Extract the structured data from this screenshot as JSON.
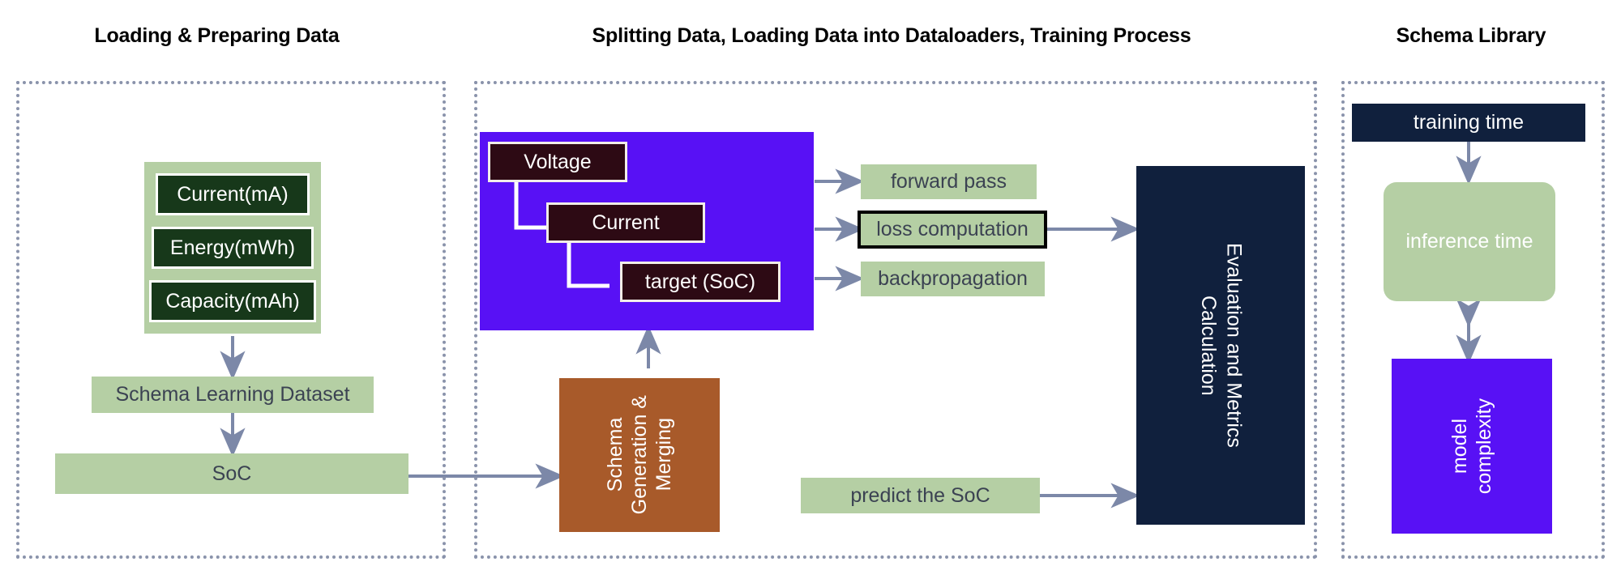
{
  "columns": [
    {
      "title": "Loading & Preparing Data"
    },
    {
      "title": "Splitting Data, Loading Data into Dataloaders, Training Process"
    },
    {
      "title": "Schema Library"
    }
  ],
  "left_column": {
    "feature_group": {
      "items": [
        {
          "label": "Current(mA)"
        },
        {
          "label": "Energy(mWh)"
        },
        {
          "label": "Capacity(mAh)"
        }
      ]
    },
    "dataset": {
      "label": "Schema Learning Dataset"
    },
    "target": {
      "label": "SoC"
    }
  },
  "middle_column": {
    "schema_box": {
      "nodes": [
        {
          "label": "Voltage"
        },
        {
          "label": "Current"
        },
        {
          "label": "target (SoC)"
        }
      ]
    },
    "steps": [
      {
        "label": "forward pass",
        "highlighted": false
      },
      {
        "label": "loss computation",
        "highlighted": true
      },
      {
        "label": "backpropagation",
        "highlighted": false
      }
    ],
    "schema_generation": {
      "label": "Schema\nGeneration &\nMerging",
      "line1": "Schema",
      "line2": "Generation &",
      "line3": "Merging"
    },
    "predict": {
      "label": "predict the SoC"
    },
    "evaluation": {
      "line1": "Evaluation and Metrics",
      "line2": "Calculation"
    }
  },
  "right_column": {
    "training_time": {
      "label": "training time"
    },
    "inference_time": {
      "label": "inference time"
    },
    "model_complexity": {
      "line1": "model",
      "line2": "complexity"
    }
  },
  "colors": {
    "green": "#b5cfa4",
    "dark_green": "#17381a",
    "navy": "#10203d",
    "purple": "#5811f5",
    "maroon": "#2d0a14",
    "brown": "#a85a2a",
    "arrow": "#7c88a8",
    "frame": "#8a93ab"
  }
}
